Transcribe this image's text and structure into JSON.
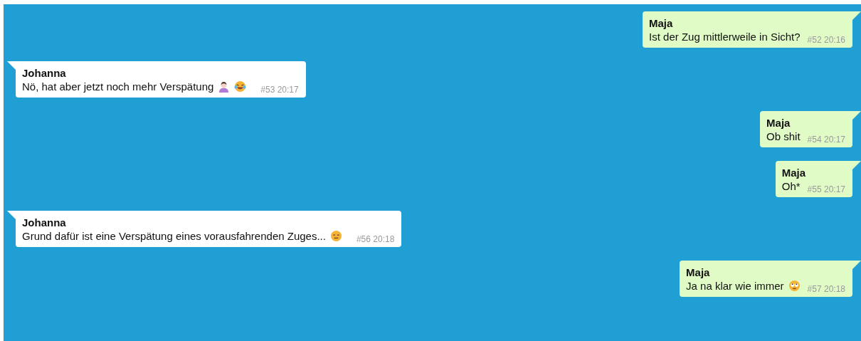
{
  "messages": [
    {
      "kind": "out",
      "sender": "Maja",
      "text": "Ist der Zug mittlerweile in Sicht?",
      "meta": "#52 20:16"
    },
    {
      "kind": "in",
      "sender": "Johanna",
      "text": "Nö, hat aber jetzt noch mehr Verspätung",
      "icons": [
        {
          "kind": "person"
        },
        {
          "kind": "laughing"
        }
      ],
      "meta": "#53 20:17"
    },
    {
      "kind": "out",
      "sender": "Maja",
      "text": "Ob shit",
      "meta": "#54 20:17"
    },
    {
      "kind": "out",
      "sender": "Maja",
      "text": "Oh*",
      "meta": "#55 20:17"
    },
    {
      "kind": "in",
      "sender": "Johanna",
      "text": "Grund dafür ist eine Verspätung eines vorausfahrenden Zuges...",
      "icons": [
        {
          "kind": "expressionless"
        }
      ],
      "meta": "#56 20:18"
    },
    {
      "kind": "out",
      "sender": "Maja",
      "text": "Ja na klar wie immer",
      "icons": [
        {
          "kind": "eyeroll"
        }
      ],
      "meta": "#57 20:18"
    }
  ]
}
